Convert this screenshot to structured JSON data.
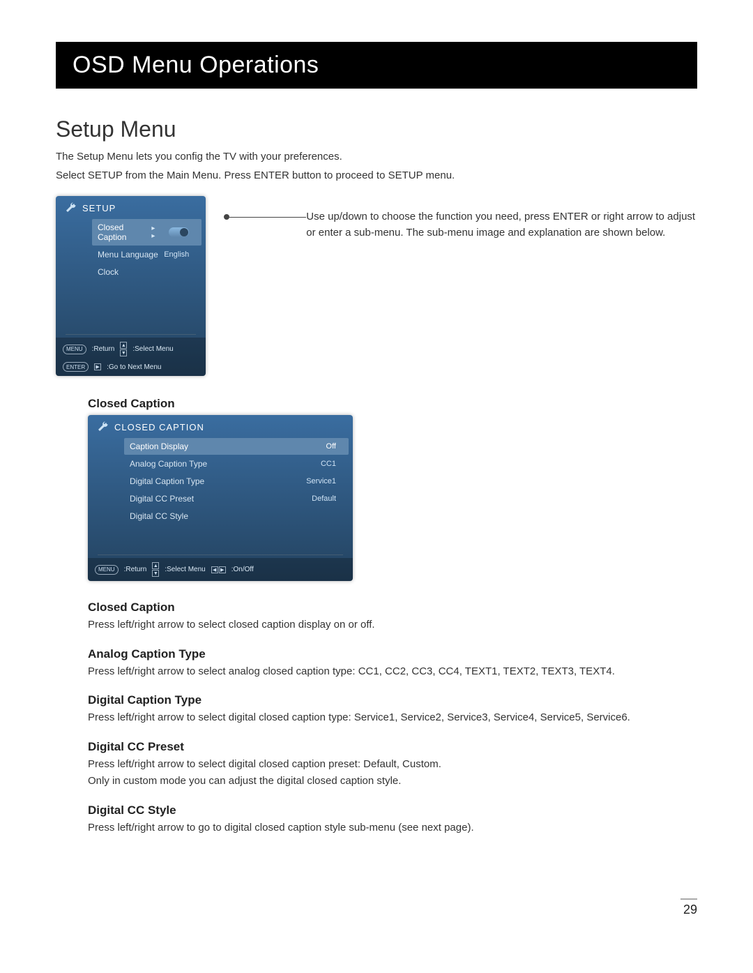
{
  "banner": "OSD Menu Operations",
  "section_title": "Setup Menu",
  "intro1": "The Setup Menu lets you config the TV with your preferences.",
  "intro2": "Select SETUP from the Main Menu. Press ENTER button to proceed to SETUP menu.",
  "side_note": "Use up/down to choose the function you need, press ENTER or right arrow to adjust or enter a sub-menu. The sub-menu image and explanation are shown below.",
  "setup_card": {
    "title": "SETUP",
    "rows": [
      {
        "label": "Closed Caption",
        "value": "▸ ▸",
        "toggle": true,
        "selected": true
      },
      {
        "label": "Menu Language",
        "value": "English",
        "selected": false
      },
      {
        "label": "Clock",
        "value": "",
        "selected": false
      }
    ],
    "footer": {
      "return_key": "MENU",
      "return_label": ":Return",
      "select_label": ":Select Menu",
      "enter_key": "ENTER",
      "next_label": ":Go to Next Menu"
    }
  },
  "cc_heading": "Closed Caption",
  "cc_card": {
    "title": "CLOSED CAPTION",
    "rows": [
      {
        "label": "Caption Display",
        "value": "Off",
        "selected": true
      },
      {
        "label": "Analog Caption Type",
        "value": "CC1",
        "selected": false
      },
      {
        "label": "Digital Caption Type",
        "value": "Service1",
        "selected": false
      },
      {
        "label": "Digital CC Preset",
        "value": "Default",
        "selected": false
      },
      {
        "label": "Digital CC Style",
        "value": "",
        "selected": false
      }
    ],
    "footer": {
      "return_key": "MENU",
      "return_label": ":Return",
      "select_label": ":Select Menu",
      "onoff_label": ":On/Off"
    }
  },
  "groups": [
    {
      "h": "Closed Caption",
      "t": [
        "Press left/right arrow to select closed caption display on or off."
      ]
    },
    {
      "h": "Analog Caption Type",
      "t": [
        "Press left/right arrow to select analog closed caption type: CC1, CC2, CC3, CC4, TEXT1, TEXT2, TEXT3, TEXT4."
      ]
    },
    {
      "h": "Digital Caption Type",
      "t": [
        "Press left/right arrow to select digital closed caption type: Service1, Service2, Service3, Service4, Service5, Service6."
      ]
    },
    {
      "h": "Digital CC Preset",
      "t": [
        "Press left/right arrow to select digital closed caption preset: Default, Custom.",
        "Only in custom mode you can adjust the digital closed caption style."
      ]
    },
    {
      "h": "Digital CC Style",
      "t": [
        "Press left/right arrow to go to digital closed caption style sub-menu (see next page)."
      ]
    }
  ],
  "page_number": "29"
}
